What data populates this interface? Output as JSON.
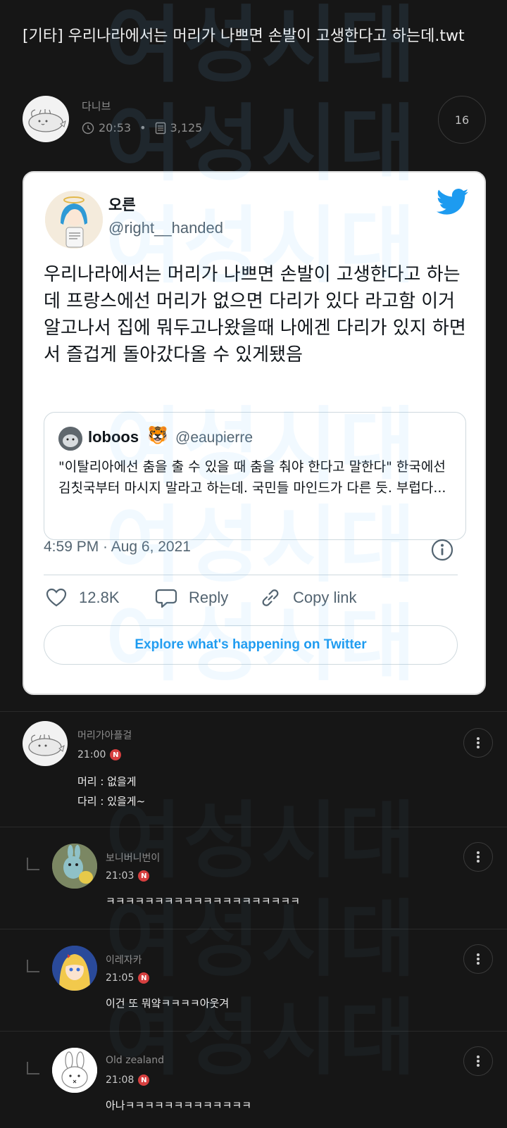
{
  "post": {
    "title": "[기타] 우리나라에서는 머리가 나쁘면 손발이 고생한다고 하는데.twt",
    "author": "다니브",
    "time": "20:53",
    "views": "3,125",
    "comment_count": "16"
  },
  "watermark": {
    "lines": [
      "여성시대",
      "여성시대",
      "여성시대",
      "여성시대",
      "여성시대",
      "여성시대",
      "여성시대",
      "여성시대",
      "여성시대",
      "여성시대",
      "여성시대"
    ]
  },
  "tweet": {
    "display_name": "오른",
    "handle": "@right__handed",
    "text": "우리나라에서는 머리가 나쁘면 손발이 고생한다고 하는데 프랑스에선 머리가 없으면 다리가 있다 라고함 이거알고나서 집에 뭐두고나왔을때 나에겐 다리가 있지 하면서 즐겁게 돌아갔다올 수 있게됐음",
    "quote": {
      "name": "loboos",
      "emoji": "🐯",
      "handle": "@eaupierre",
      "text": "\"이탈리아에선 춤을 출 수 있을 때 춤을 춰야 한다고 말한다\" 한국에선 김칫국부터 마시지 말라고 하는데. 국민들 마인드가 다른 듯. 부럽다..."
    },
    "timestamp": "4:59 PM · Aug 6, 2021",
    "likes": "12.8K",
    "reply_label": "Reply",
    "copy_link_label": "Copy link",
    "explore_label": "Explore what's happening on Twitter",
    "brand_color": "#1d9bf0"
  },
  "comments": [
    {
      "name": "머리가아플걸",
      "time": "21:00",
      "badge": "N",
      "text": "머리 : 없을게\n다리 : 있을게~"
    },
    {
      "name": "보니버니번이",
      "time": "21:03",
      "badge": "N",
      "text": "ㅋㅋㅋㅋㅋㅋㅋㅋㅋㅋㅋㅋㅋㅋㅋㅋㅋㅋㅋㅋ"
    },
    {
      "name": "이레자카",
      "time": "21:05",
      "badge": "N",
      "text": "이건 또 뭐얔ㅋㅋㅋㅋ아웃겨"
    },
    {
      "name": "Old zealand",
      "time": "21:08",
      "badge": "N",
      "text": "아나ㅋㅋㅋㅋㅋㅋㅋㅋㅋㅋㅋㅋㅋ"
    }
  ]
}
